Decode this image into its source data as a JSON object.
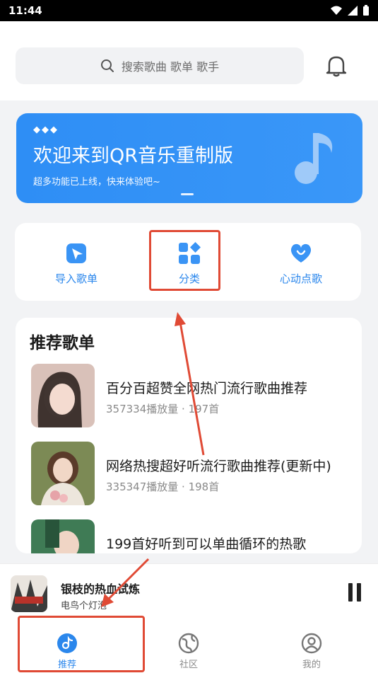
{
  "status": {
    "time": "11:44"
  },
  "search": {
    "placeholder": "搜索歌曲 歌单 歌手"
  },
  "banner": {
    "dots": "◆◆◆",
    "title": "欢迎来到QR音乐重制版",
    "subtitle": "超多功能已上线，快来体验吧~"
  },
  "quick_actions": [
    {
      "label": "导入歌单",
      "icon": "import-icon"
    },
    {
      "label": "分类",
      "icon": "category-icon"
    },
    {
      "label": "心动点歌",
      "icon": "heart-icon"
    }
  ],
  "recommend": {
    "title": "推荐歌单",
    "playlists": [
      {
        "title": "百分百超赞全网热门流行歌曲推荐",
        "meta": "357334播放量 · 197首"
      },
      {
        "title": "网络热搜超好听流行歌曲推荐(更新中)",
        "meta": "335347播放量 · 198首"
      },
      {
        "title": "199首好听到可以单曲循环的热歌",
        "meta": ""
      }
    ]
  },
  "player": {
    "title": "银枝的热血试炼",
    "artist": "电鸟个灯泡"
  },
  "tabs": [
    {
      "label": "推荐",
      "icon": "music-disc-icon",
      "active": true
    },
    {
      "label": "社区",
      "icon": "globe-icon",
      "active": false
    },
    {
      "label": "我的",
      "icon": "user-icon",
      "active": false
    }
  ],
  "colors": {
    "accent": "#2b87ec",
    "banner": "#3393f6",
    "annotation": "#e04a35"
  }
}
